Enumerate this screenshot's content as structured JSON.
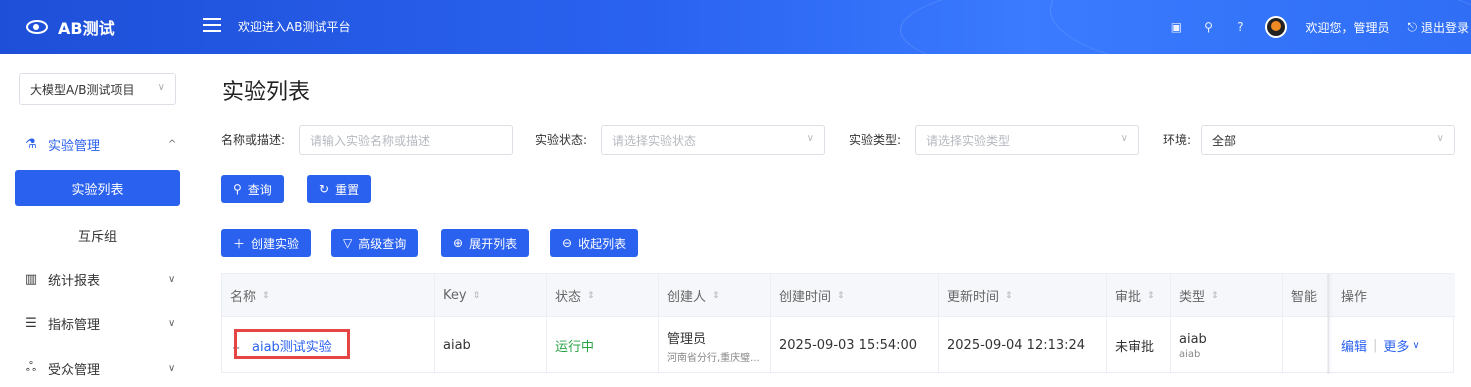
{
  "header": {
    "app_title": "AB测试",
    "welcome": "欢迎进入AB测试平台",
    "user_greeting": "欢迎您，管理员",
    "logout_label": "退出登录",
    "icons": [
      "eye-icon",
      "menu-toggle-icon",
      "screen-icon",
      "search-icon",
      "help-icon",
      "avatar",
      "logout-icon"
    ]
  },
  "sidebar": {
    "project": "大模型A/B测试项目",
    "items": [
      {
        "label": "实验管理",
        "icon": "flask-icon",
        "expanded": true
      },
      {
        "label": "实验列表",
        "active": true
      },
      {
        "label": "互斥组"
      },
      {
        "label": "统计报表",
        "icon": "bar-chart-icon"
      },
      {
        "label": "指标管理",
        "icon": "list-icon"
      },
      {
        "label": "受众管理",
        "icon": "users-icon"
      }
    ]
  },
  "page": {
    "title": "实验列表",
    "filters": {
      "name_label": "名称或描述:",
      "name_placeholder": "请输入实验名称或描述",
      "status_label": "实验状态:",
      "status_placeholder": "请选择实验状态",
      "type_label": "实验类型:",
      "type_placeholder": "请选择实验类型",
      "env_label": "环境:",
      "env_value": "全部"
    },
    "buttons": {
      "query": "查询",
      "reset": "重置",
      "create": "创建实验",
      "advanced": "高级查询",
      "expand": "展开列表",
      "collapse": "收起列表"
    },
    "table": {
      "headers": [
        "名称",
        "Key",
        "状态",
        "创建人",
        "创建时间",
        "更新时间",
        "审批",
        "类型",
        "智能",
        "操作"
      ],
      "rows": [
        {
          "name": "aiab测试实验",
          "key": "aiab",
          "status": "运行中",
          "creator": "管理员",
          "creator_org": "河南省分行,重庆璧...",
          "created": "2025-09-03 15:54:00",
          "updated": "2025-09-04 12:13:24",
          "approval": "未审批",
          "type": "aiab",
          "type_sub": "aiab",
          "smart": "",
          "edit": "编辑",
          "more": "更多"
        }
      ]
    }
  }
}
